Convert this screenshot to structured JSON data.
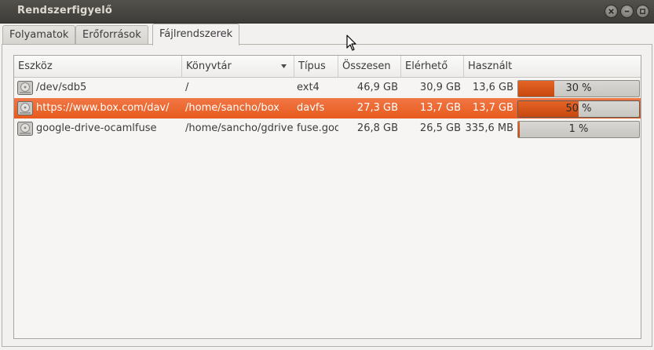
{
  "window": {
    "title": "Rendszerfigyelő"
  },
  "tabs": [
    {
      "label": "Folyamatok",
      "active": false
    },
    {
      "label": "Erőforrások",
      "active": false
    },
    {
      "label": "Fájlrendszerek",
      "active": true
    }
  ],
  "table": {
    "columns": [
      "Eszköz",
      "Könyvtár",
      "Típus",
      "Összesen",
      "Elérhető",
      "Használt"
    ],
    "sorted_column": "Könyvtár",
    "rows": [
      {
        "device": "/dev/sdb5",
        "directory": "/",
        "type": "ext4",
        "total": "46,9 GB",
        "available": "30,9 GB",
        "used": "13,6 GB",
        "used_percent": 30,
        "used_percent_label": "30 %",
        "selected": false
      },
      {
        "device": "https://www.box.com/dav/",
        "directory": "/home/sancho/box",
        "type": "davfs",
        "total": "27,3 GB",
        "available": "13,7 GB",
        "used": "13,7 GB",
        "used_percent": 50,
        "used_percent_label": "50 %",
        "selected": true
      },
      {
        "device": "google-drive-ocamlfuse",
        "directory": "/home/sancho/gdrive",
        "type": "fuse.google-drive-ocamlfuse",
        "total": "26,8 GB",
        "available": "26,5 GB",
        "used": "335,6 MB",
        "used_percent": 1,
        "used_percent_label": "1 %",
        "selected": false
      }
    ]
  },
  "colors": {
    "selection": "#e85a1c",
    "bar_fill": "#d9541a",
    "titlebar": "#3d3c38"
  },
  "icons": {
    "row_icon": "hard-drive-icon",
    "close": "close-icon",
    "minimize": "minimize-icon",
    "maximize": "maximize-icon"
  }
}
